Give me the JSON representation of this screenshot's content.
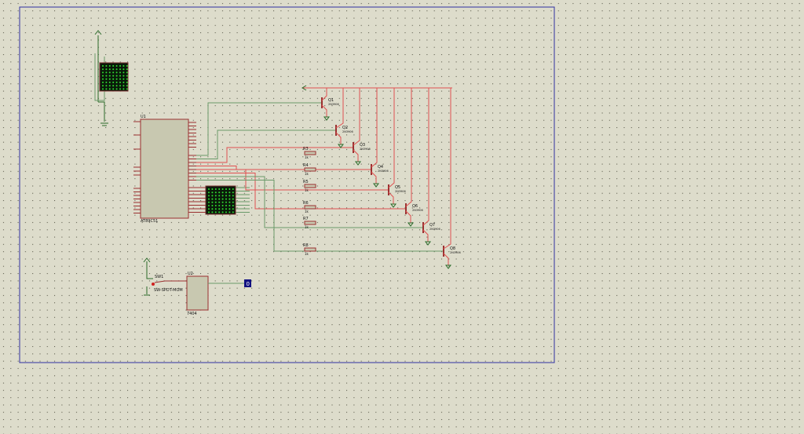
{
  "schematic": {
    "colors": {
      "background": "#dddccb",
      "grid_dot": "#4a4a3a",
      "border": "#3030a0",
      "wire_red": "#e05050",
      "wire_green": "#6a9a6a",
      "component": "#9a3030",
      "chip_fill": "#c8c8b0",
      "matrix": "#0a1a0a",
      "led": "#30e030",
      "display": "#101080"
    },
    "u1": {
      "ref": "U1",
      "part": "AT89C51"
    },
    "u2": {
      "ref": "U2",
      "part": "7404"
    },
    "switch": {
      "ref": "SW1",
      "part": "SW-SPDT-MOM"
    },
    "display_value": "0",
    "transistors": [
      {
        "ref": "Q1",
        "part": "2N3906"
      },
      {
        "ref": "Q2",
        "part": "2N3906"
      },
      {
        "ref": "Q3",
        "part": "2N3906"
      },
      {
        "ref": "Q4",
        "part": "2N3906"
      },
      {
        "ref": "Q5",
        "part": "2N3906"
      },
      {
        "ref": "Q6",
        "part": "2N3906"
      },
      {
        "ref": "Q7",
        "part": "2N3906"
      },
      {
        "ref": "Q8",
        "part": "2N3906"
      }
    ],
    "resistors": [
      {
        "ref": "R3",
        "value": "1k"
      },
      {
        "ref": "R4",
        "value": "1k"
      },
      {
        "ref": "R5",
        "value": "1k"
      },
      {
        "ref": "R6",
        "value": "1k"
      },
      {
        "ref": "R7",
        "value": "1k"
      },
      {
        "ref": "R8",
        "value": "1k"
      }
    ]
  }
}
